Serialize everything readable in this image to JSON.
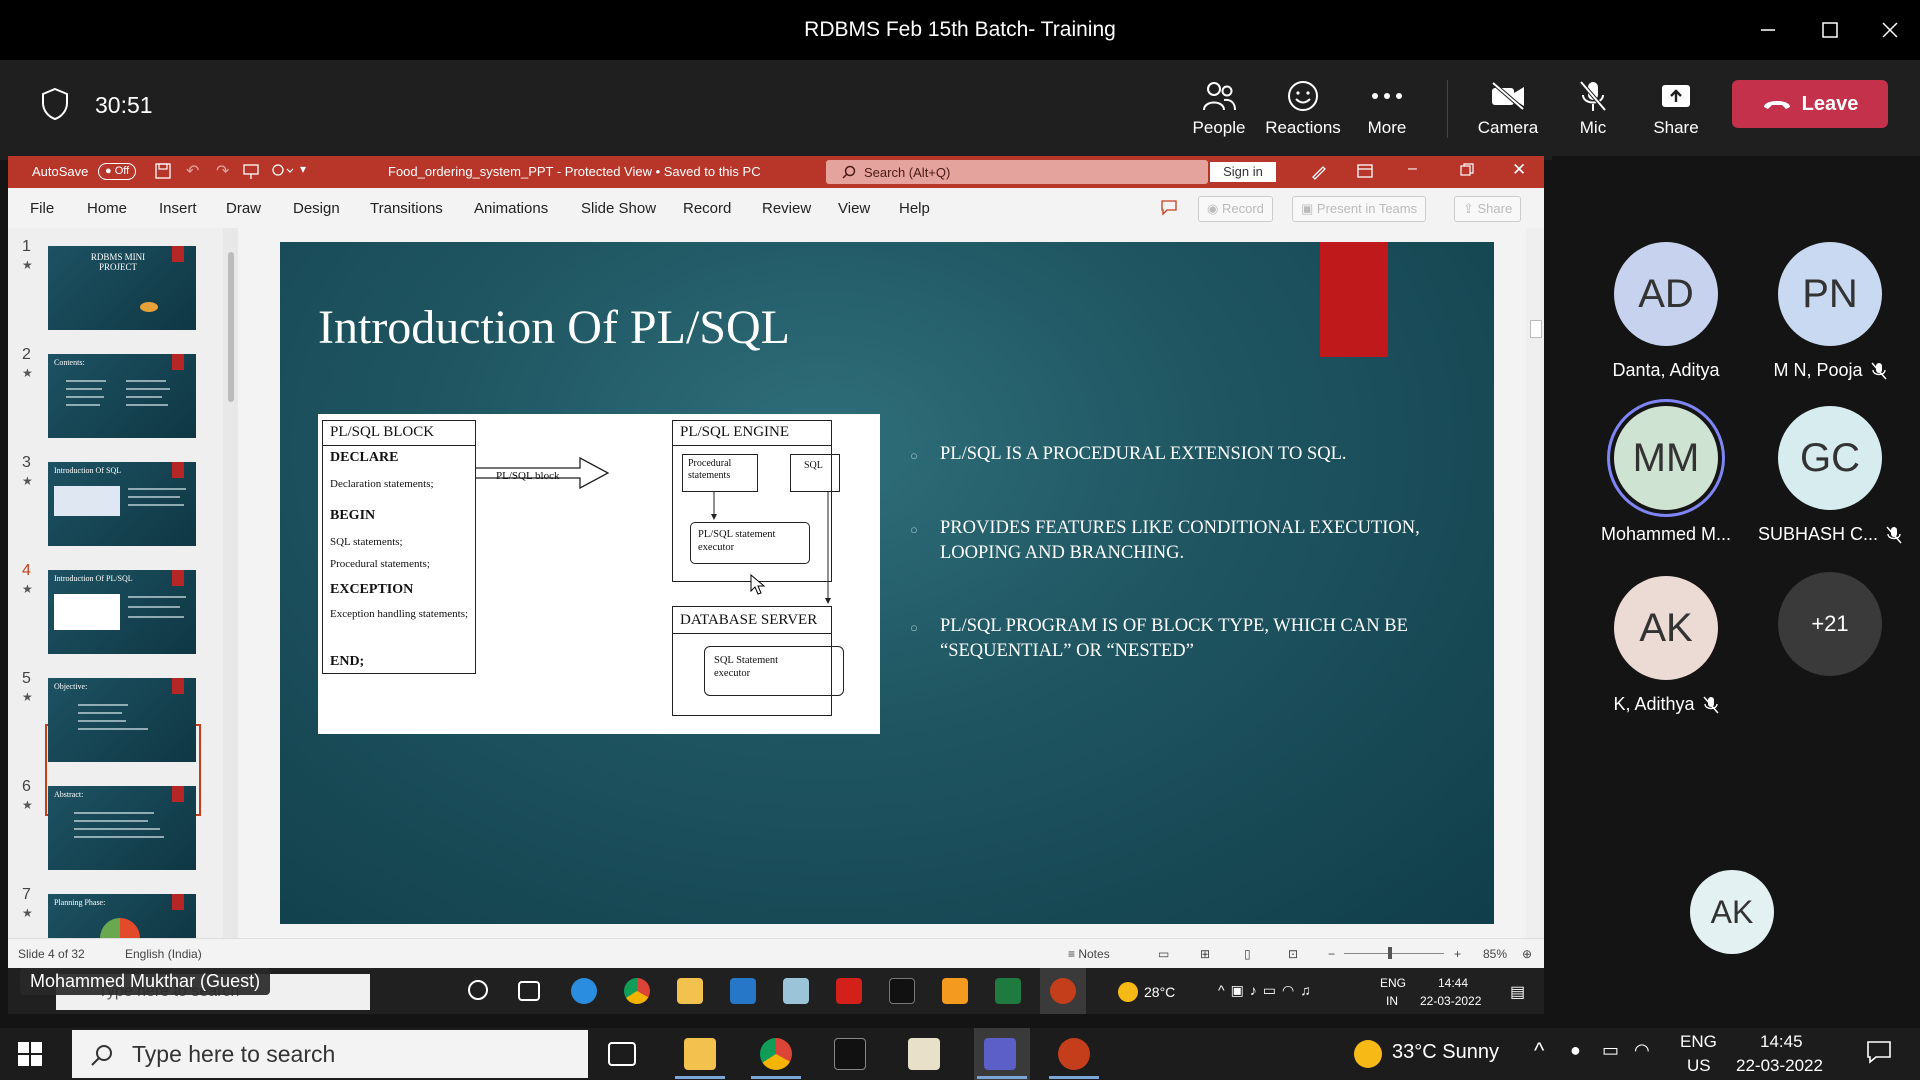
{
  "window": {
    "title": "RDBMS Feb 15th Batch- Training"
  },
  "meeting": {
    "timer": "30:51",
    "buttons": {
      "people": "People",
      "reactions": "Reactions",
      "more": "More",
      "camera": "Camera",
      "mic": "Mic",
      "share": "Share"
    },
    "leave_label": "Leave",
    "accent": "#c4314b"
  },
  "ppt": {
    "autosave_label": "AutoSave",
    "autosave_state": "Off",
    "file_title": "Food_ordering_system_PPT  -  Protected View • Saved to this PC",
    "search_placeholder": "Search (Alt+Q)",
    "sign_in": "Sign in",
    "menu": [
      "File",
      "Home",
      "Insert",
      "Draw",
      "Design",
      "Transitions",
      "Animations",
      "Slide Show",
      "Record",
      "Review",
      "View",
      "Help"
    ],
    "ribbon_buttons": {
      "record": "Record",
      "present": "Present in Teams",
      "share": "Share"
    },
    "thumbnails": [
      {
        "num": "1",
        "title": "RDBMS MINI PROJECT"
      },
      {
        "num": "2",
        "title": "Contents:"
      },
      {
        "num": "3",
        "title": "Introduction Of SQL"
      },
      {
        "num": "4",
        "title": "Introduction Of PL/SQL"
      },
      {
        "num": "5",
        "title": "Objective:"
      },
      {
        "num": "6",
        "title": "Abstract:"
      },
      {
        "num": "7",
        "title": "Planning Phase:"
      }
    ],
    "status": {
      "slide": "Slide 4 of 32",
      "language": "English (India)",
      "notes": "Notes",
      "zoom": "85%"
    },
    "accent": "#b8352a"
  },
  "slide": {
    "title": "Introduction Of PL/SQL",
    "diagram": {
      "block_title": "PL/SQL BLOCK",
      "declare": "DECLARE",
      "declaration": "Declaration statements;",
      "begin": "BEGIN",
      "sql_statements": "SQL statements;",
      "procedural_statements": "Procedural statements;",
      "exception": "EXCEPTION",
      "exception_handling": "Exception handling statements;",
      "end": "END;",
      "arrow_label": "PL/SQL block",
      "engine_title": "PL/SQL ENGINE",
      "procedural": "Procedural statements",
      "sql": "SQL",
      "executor": "PL/SQL statement executor",
      "db_title": "DATABASE SERVER",
      "sql_executor": "SQL Statement executor"
    },
    "bullets": [
      "PL/SQL IS A PROCEDURAL EXTENSION TO SQL.",
      "PROVIDES FEATURES LIKE CONDITIONAL EXECUTION, LOOPING AND BRANCHING.",
      "PL/SQL PROGRAM IS OF BLOCK TYPE, WHICH CAN BE “SEQUENTIAL” OR “NESTED”"
    ]
  },
  "inner_taskbar": {
    "search": "Type here to search",
    "weather": "28°C",
    "lang1": "ENG",
    "lang2": "IN",
    "time": "14:44",
    "date": "22-03-2022"
  },
  "presenter_label": "Mohammed Mukthar (Guest)",
  "participants": [
    {
      "initials": "AD",
      "name": "Danta, Aditya",
      "muted": false,
      "color": "#c7d3ee"
    },
    {
      "initials": "PN",
      "name": "M N, Pooja",
      "muted": true,
      "color": "#cad9f2"
    },
    {
      "initials": "MM",
      "name": "Mohammed M...",
      "muted": false,
      "color": "#cfe3d2"
    },
    {
      "initials": "GC",
      "name": "SUBHASH C...",
      "muted": true,
      "color": "#d7ecef"
    },
    {
      "initials": "AK",
      "name": "K, Adithya",
      "muted": true,
      "color": "#ecdad5"
    },
    {
      "initials": "+21",
      "name": "",
      "muted": false,
      "color": "#3a3a3a"
    }
  ],
  "self_initials": "AK",
  "taskbar": {
    "search": "Type here to search",
    "weather": "33°C  Sunny",
    "lang1": "ENG",
    "lang2": "US",
    "time": "14:45",
    "date": "22-03-2022"
  }
}
